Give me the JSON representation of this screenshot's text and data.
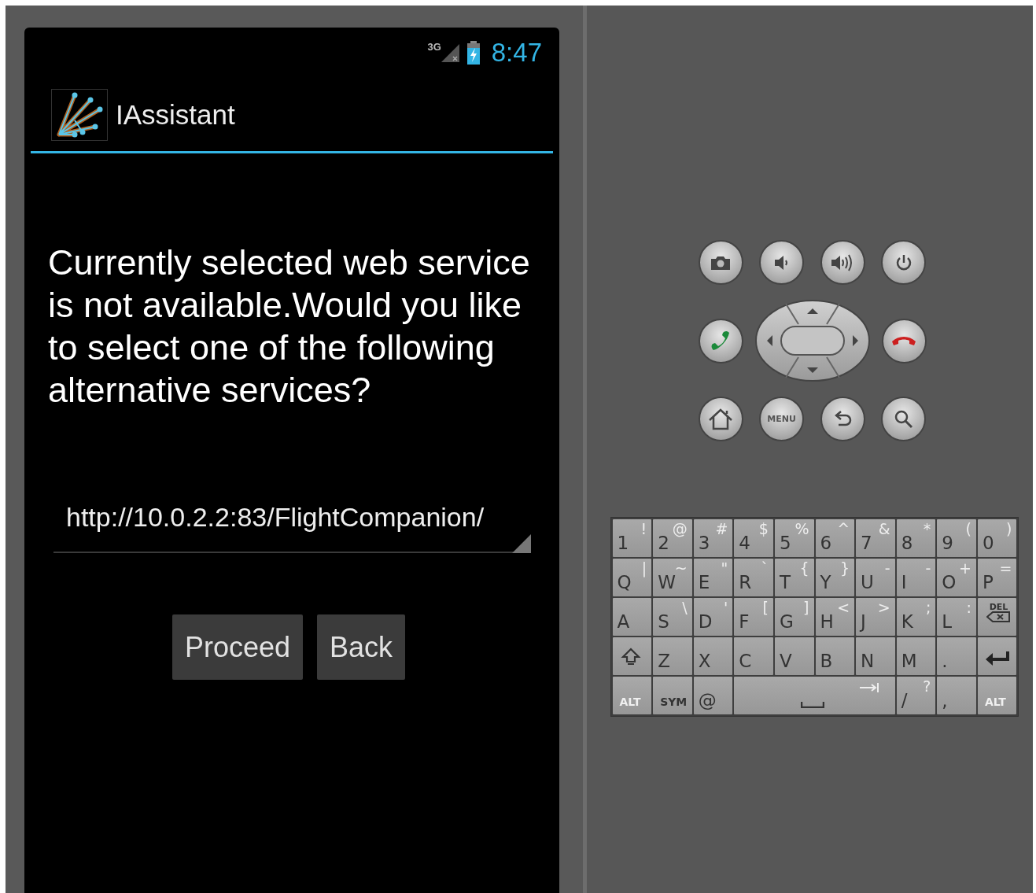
{
  "status_bar": {
    "network": "3G",
    "time": "8:47"
  },
  "action_bar": {
    "title": "IAssistant"
  },
  "message": "Currently selected web service is not available.Would you like to select one of the following alternative services?",
  "url_field": {
    "value": "http://10.0.2.2:83/FlightCompanion/"
  },
  "buttons": [
    {
      "label": "Proceed"
    },
    {
      "label": "Back"
    }
  ],
  "hardware_buttons": [
    {
      "kind": "camera"
    },
    {
      "kind": "volume-down"
    },
    {
      "kind": "volume-up"
    },
    {
      "kind": "power"
    },
    {
      "kind": "call"
    },
    {
      "kind": "dpad"
    },
    {
      "kind": "end-call"
    },
    {
      "kind": "home"
    },
    {
      "kind": "menu",
      "label": "MENU"
    },
    {
      "kind": "back"
    },
    {
      "kind": "search"
    }
  ],
  "keyboard": {
    "rows": [
      [
        {
          "label": "1",
          "alt": "!"
        },
        {
          "label": "2",
          "alt": "@"
        },
        {
          "label": "3",
          "alt": "#"
        },
        {
          "label": "4",
          "alt": "$"
        },
        {
          "label": "5",
          "alt": "%"
        },
        {
          "label": "6",
          "alt": "^"
        },
        {
          "label": "7",
          "alt": "&"
        },
        {
          "label": "8",
          "alt": "*"
        },
        {
          "label": "9",
          "alt": "("
        },
        {
          "label": "0",
          "alt": ")"
        }
      ],
      [
        {
          "label": "Q",
          "alt": "|"
        },
        {
          "label": "W",
          "alt": "~"
        },
        {
          "label": "E",
          "alt": "\""
        },
        {
          "label": "R",
          "alt": "`"
        },
        {
          "label": "T",
          "alt": "{"
        },
        {
          "label": "Y",
          "alt": "}"
        },
        {
          "label": "U",
          "alt": "-"
        },
        {
          "label": "I",
          "alt": "-"
        },
        {
          "label": "O",
          "alt": "+"
        },
        {
          "label": "P",
          "alt": "="
        }
      ],
      [
        {
          "label": "A"
        },
        {
          "label": "S",
          "alt": "\\"
        },
        {
          "label": "D",
          "alt": "'"
        },
        {
          "label": "F",
          "alt": "["
        },
        {
          "label": "G",
          "alt": "]"
        },
        {
          "label": "H",
          "alt": "<"
        },
        {
          "label": "J",
          "alt": ">"
        },
        {
          "label": "K",
          "alt": ";"
        },
        {
          "label": "L",
          "alt": ":"
        },
        {
          "kind": "del",
          "label": "DEL"
        }
      ],
      [
        {
          "kind": "shift"
        },
        {
          "label": "Z"
        },
        {
          "label": "X"
        },
        {
          "label": "C"
        },
        {
          "label": "V"
        },
        {
          "label": "B"
        },
        {
          "label": "N"
        },
        {
          "label": "M"
        },
        {
          "label": "."
        },
        {
          "kind": "enter"
        }
      ]
    ],
    "bottom_row": [
      {
        "kind": "alt",
        "label": "ALT"
      },
      {
        "kind": "sym",
        "label": "SYM"
      },
      {
        "label": "@"
      },
      {
        "kind": "space"
      },
      {
        "label": "/",
        "alt": "?"
      },
      {
        "label": ","
      },
      {
        "kind": "alt",
        "label": "ALT"
      }
    ]
  }
}
